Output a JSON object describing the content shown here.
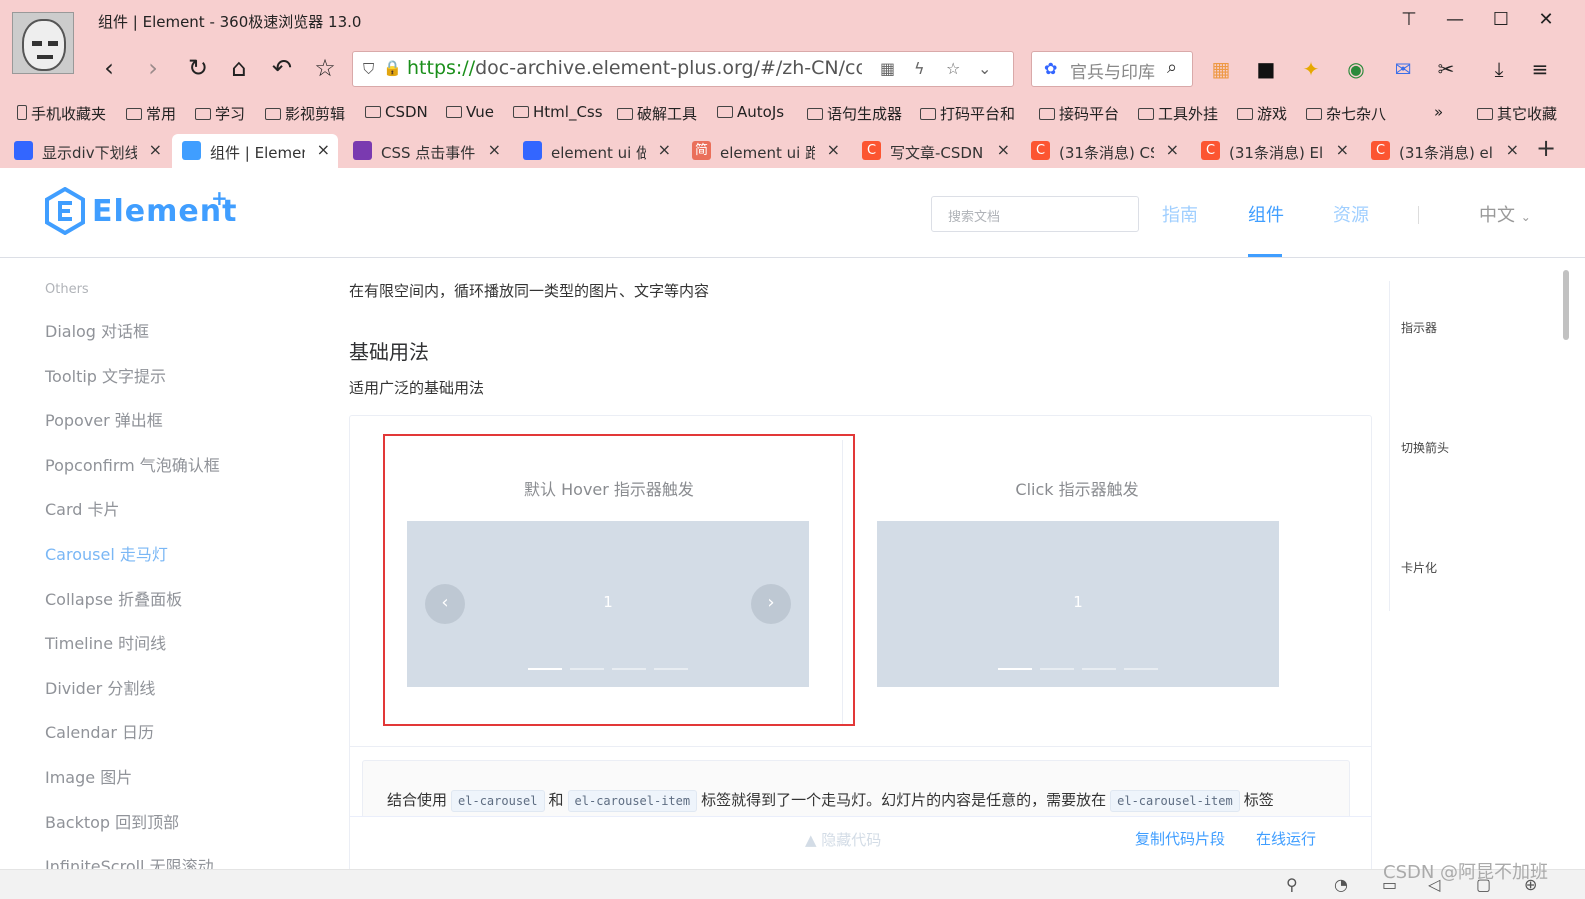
{
  "window": {
    "title": "组件 | Element - 360极速浏览器 13.0"
  },
  "address": {
    "scheme": "https://",
    "rest": "doc-archive.element-plus.org/#/zh-CN/compon"
  },
  "search_box": {
    "query": "官兵与印库"
  },
  "bookmarks": [
    "手机收藏夹",
    "常用",
    "学习",
    "影视剪辑",
    "CSDN",
    "Vue",
    "Html_Css",
    "破解工具",
    "AutoJs",
    "语句生成器",
    "打码平台和",
    "接码平台",
    "工具外挂",
    "游戏",
    "杂七杂八",
    "»",
    "其它收藏"
  ],
  "tabs": [
    {
      "label": "显示div下划线",
      "icon": "baidu-icon",
      "color": "#3366ff"
    },
    {
      "label": "组件 | Element",
      "icon": "element-icon",
      "color": "#409eff"
    },
    {
      "label": "CSS 点击事件",
      "icon": "sogou-icon",
      "color": "#7a3ab0"
    },
    {
      "label": "element ui 做",
      "icon": "baidu-icon",
      "color": "#3366ff"
    },
    {
      "label": "element ui 跑",
      "icon": "jianshu-icon",
      "color": "#ea6f5a"
    },
    {
      "label": "写文章-CSDN",
      "icon": "csdn-icon",
      "color": "#fc5531"
    },
    {
      "label": "(31条消息) CS",
      "icon": "csdn-icon",
      "color": "#fc5531"
    },
    {
      "label": "(31条消息) El",
      "icon": "csdn-icon",
      "color": "#fc5531"
    },
    {
      "label": "(31条消息) el",
      "icon": "csdn-icon",
      "color": "#fc5531"
    }
  ],
  "header": {
    "logo": "Element",
    "logo_plus": "+",
    "search_placeholder": "搜索文档",
    "nav": [
      "指南",
      "组件",
      "资源"
    ],
    "lang": "中文"
  },
  "sidebar": {
    "group": "Others",
    "items": [
      "Dialog 对话框",
      "Tooltip 文字提示",
      "Popover 弹出框",
      "Popconfirm 气泡确认框",
      "Card 卡片",
      "Carousel 走马灯",
      "Collapse 折叠面板",
      "Timeline 时间线",
      "Divider 分割线",
      "Calendar 日历",
      "Image 图片",
      "Backtop 回到顶部",
      "InfiniteScroll 无限滚动"
    ],
    "active": "Carousel 走马灯"
  },
  "content": {
    "intro": "在有限空间内，循环播放同一类型的图片、文字等内容",
    "section_title": "基础用法",
    "section_sub": "适用广泛的基础用法",
    "demo1_title": "默认 Hover 指示器触发",
    "demo2_title": "Click 指示器触发",
    "slide_number": "1",
    "prev_arrow": "‹",
    "next_arrow": "›",
    "desc_pre": "结合使用",
    "code1": "el-carousel",
    "desc_and": "和",
    "code2": "el-carousel-item",
    "desc_mid": "标签就得到了一个走马灯。幻灯片的内容是任意的，需要放在",
    "code3": "el-carousel-item",
    "desc_end": "标签",
    "hide_code": "▲  隐藏代码",
    "copy": "复制代码片段",
    "run": "在线运行"
  },
  "toc": [
    "指示器",
    "切换箭头",
    "卡片化"
  ],
  "watermark": "CSDN @阿昆不加班",
  "colors": {
    "accent": "#409eff",
    "highlight_box": "#e23838",
    "chrome": "#f7cfcf",
    "carousel_bg": "#d3dce6"
  }
}
